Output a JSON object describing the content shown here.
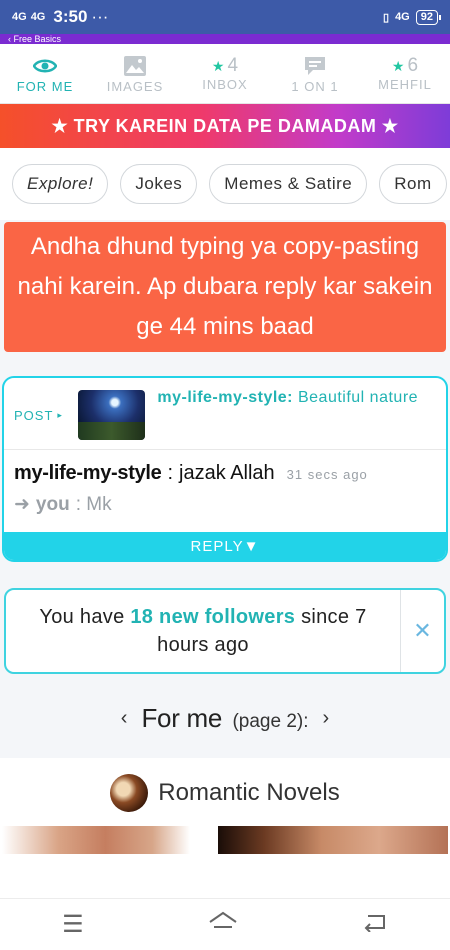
{
  "status_bar": {
    "net1": "4G",
    "net2": "4G",
    "time": "3:50",
    "dots": "···",
    "net3": "4G",
    "battery": "92"
  },
  "top_strip": {
    "text": "‹ Free Basics"
  },
  "tabs": [
    {
      "label": "FOR ME",
      "icon": "eye-icon",
      "active": true
    },
    {
      "label": "IMAGES",
      "icon": "image-icon"
    },
    {
      "label": "INBOX",
      "icon": "star-icon",
      "count": "4"
    },
    {
      "label": "1 ON 1",
      "icon": "chat-icon"
    },
    {
      "label": "MEHFIL",
      "icon": "star-icon",
      "count": "6"
    }
  ],
  "promo": {
    "text": "★ TRY KAREIN DATA PE DAMADAM ★"
  },
  "chips": [
    "Explore!",
    "Jokes",
    "Memes & Satire",
    "Rom"
  ],
  "warning": {
    "text": "Andha dhund typing ya copy-pasting nahi karein. Ap dubara reply kar sakein ge 44 mins baad"
  },
  "post": {
    "tag": "POST",
    "author": "my-life-my-style:",
    "title": "Beautiful nature",
    "reply_user": "my-life-my-style",
    "reply_sep": ":",
    "reply_text": "jazak Allah",
    "reply_time": "31 secs ago",
    "you_label": "you",
    "you_text": ": Mk",
    "reply_button": "REPLY▼"
  },
  "followers": {
    "prefix": "You have",
    "highlight": "18 new followers",
    "suffix": "since 7 hours ago"
  },
  "pager": {
    "title": "For me",
    "sub": "(page 2):"
  },
  "topic": {
    "title": "Romantic Novels"
  },
  "colors": {
    "accent": "#22b3b3",
    "warning": "#fa6545",
    "reply_bar": "#22d3e8"
  }
}
